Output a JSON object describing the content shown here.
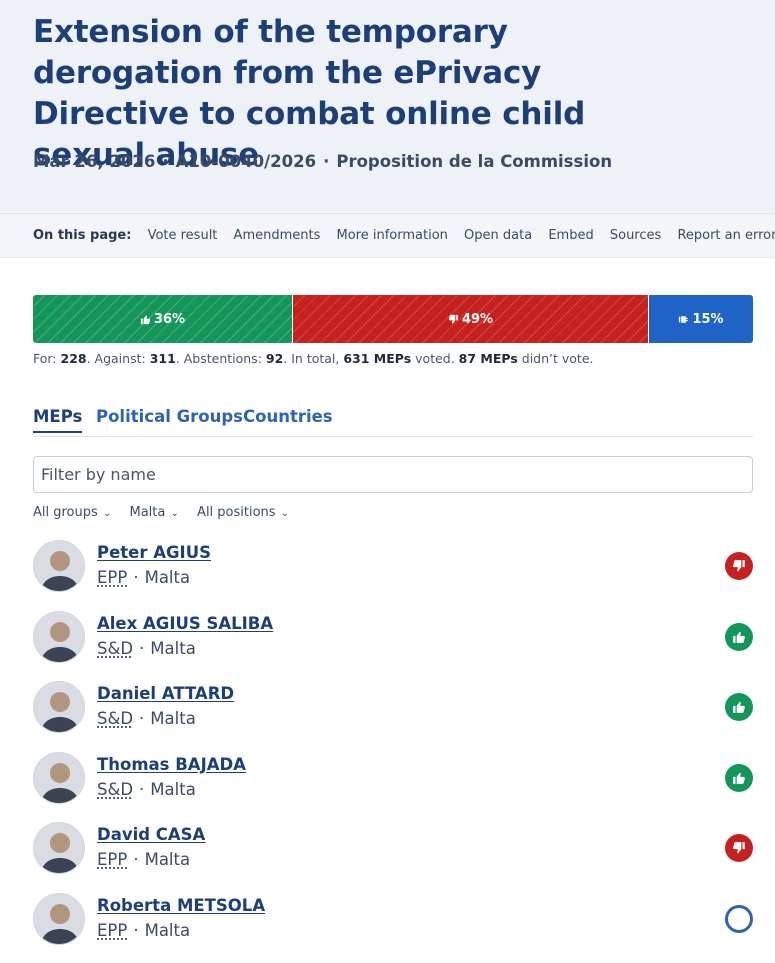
{
  "header": {
    "title": "Extension of the temporary derogation from the ePrivacy Directive to combat online child sexual abuse",
    "date": "Mar 26, 2026",
    "reference": "A10-0040/2026",
    "procedure": "Proposition de la Commission",
    "separator": "·"
  },
  "onpage": {
    "label": "On this page:",
    "links": [
      "Vote result",
      "Amendments",
      "More information",
      "Open data",
      "Embed",
      "Sources",
      "Report an error"
    ]
  },
  "result": {
    "for_pct": "36%",
    "against_pct": "49%",
    "abstention_pct": "15%",
    "for_fraction": 0.36,
    "against_fraction": 0.49,
    "abstention_fraction": 0.15
  },
  "summary": {
    "for_label": "For: ",
    "for": "228",
    "against_label": ". Against: ",
    "against": "311",
    "abst_label": ". Abstentions: ",
    "abstentions": "92",
    "total_label": ". In total, ",
    "voted": "631 MEPs",
    "voted_suffix": " voted. ",
    "did_not_vote": "87 MEPs",
    "did_not_vote_suffix": " didn’t vote."
  },
  "tabs": [
    "MEPs",
    "Political Groups",
    "Countries"
  ],
  "filter": {
    "placeholder": "Filter by name"
  },
  "dropdowns": {
    "group": "All groups",
    "country": "Malta",
    "position": "All positions"
  },
  "meps": [
    {
      "name": "Peter AGIUS",
      "group": "EPP",
      "country": "Malta",
      "vote": "against"
    },
    {
      "name": "Alex AGIUS SALIBA",
      "group": "S&D",
      "country": "Malta",
      "vote": "for"
    },
    {
      "name": "Daniel ATTARD",
      "group": "S&D",
      "country": "Malta",
      "vote": "for"
    },
    {
      "name": "Thomas BAJADA",
      "group": "S&D",
      "country": "Malta",
      "vote": "for"
    },
    {
      "name": "David CASA",
      "group": "EPP",
      "country": "Malta",
      "vote": "against"
    },
    {
      "name": "Roberta METSOLA",
      "group": "EPP",
      "country": "Malta",
      "vote": "did-not-vote"
    }
  ],
  "colors": {
    "for": "#14965a",
    "against": "#c5221f",
    "abstention": "#1f63c6",
    "title": "#1d3f77"
  }
}
